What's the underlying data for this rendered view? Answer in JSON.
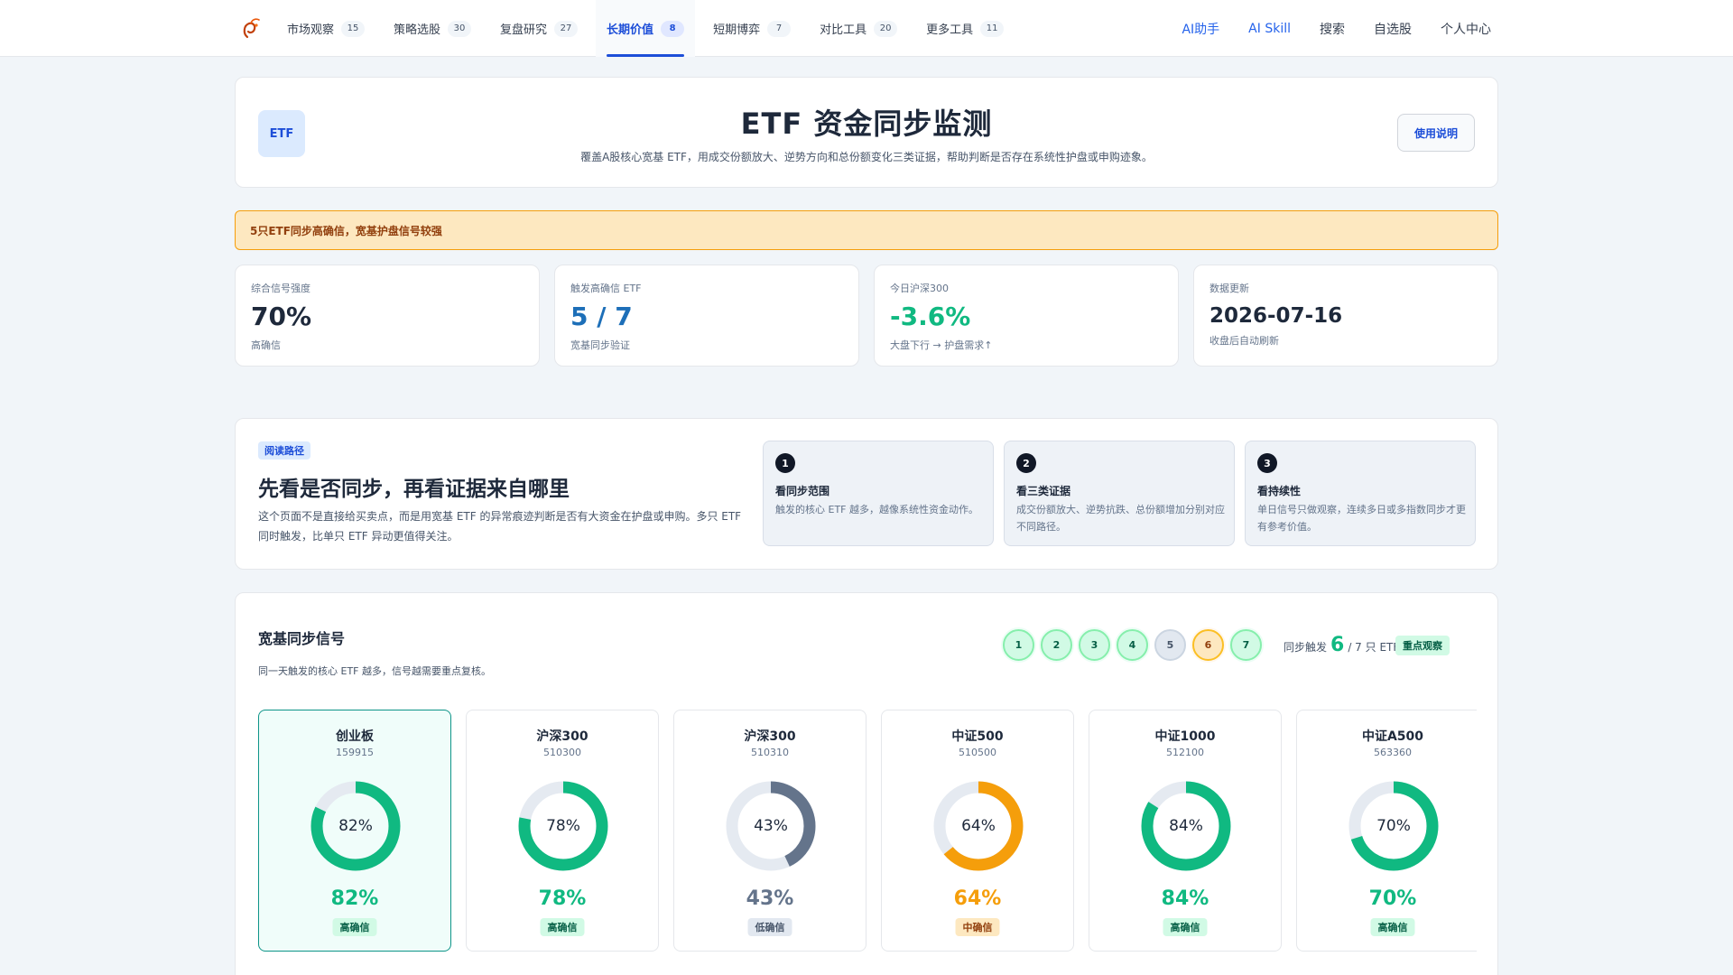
{
  "nav": {
    "tabs": [
      {
        "label": "市场观察",
        "count": "15"
      },
      {
        "label": "策略选股",
        "count": "30"
      },
      {
        "label": "复盘研究",
        "count": "27"
      },
      {
        "label": "长期价值",
        "count": "8"
      },
      {
        "label": "短期博弈",
        "count": "7"
      },
      {
        "label": "对比工具",
        "count": "20"
      },
      {
        "label": "更多工具",
        "count": "11"
      }
    ],
    "active_tab_index": 3,
    "links": {
      "ai_assistant": "AI助手",
      "ai_skill": "AI Skill",
      "search": "搜索",
      "watchlist": "自选股",
      "profile": "个人中心"
    }
  },
  "hero": {
    "badge": "ETF",
    "title": "ETF 资金同步监测",
    "subtitle": "覆盖A股核心宽基 ETF，用成交份额放大、逆势方向和总份额变化三类证据，帮助判断是否存在系统性护盘或申购迹象。",
    "help_button": "使用说明"
  },
  "alert": "5只ETF同步高确信，宽基护盘信号较强",
  "stats": [
    {
      "label": "综合信号强度",
      "value": "70%",
      "note": "高确信",
      "color": "#1e293b"
    },
    {
      "label": "触发高确信 ETF",
      "value": "5 / 7",
      "note": "宽基同步验证",
      "color": "#1d6fb8"
    },
    {
      "label": "今日沪深300",
      "value": "-3.6%",
      "note": "大盘下行 → 护盘需求↑",
      "color": "#10b981"
    },
    {
      "label": "数据更新",
      "value": "2026-07-16",
      "note": "收盘后自动刷新",
      "color": "#1e293b"
    }
  ],
  "guide": {
    "tag": "阅读路径",
    "title": "先看是否同步，再看证据来自哪里",
    "desc": "这个页面不是直接给买卖点，而是用宽基 ETF 的异常痕迹判断是否有大资金在护盘或申购。多只 ETF 同时触发，比单只 ETF 异动更值得关注。",
    "steps": [
      {
        "num": "1",
        "title": "看同步范围",
        "text": "触发的核心 ETF 越多，越像系统性资金动作。"
      },
      {
        "num": "2",
        "title": "看三类证据",
        "text": "成交份额放大、逆势抗跌、总份额增加分别对应不同路径。"
      },
      {
        "num": "3",
        "title": "看持续性",
        "text": "单日信号只做观察，连续多日或多指数同步才更有参考价值。"
      }
    ]
  },
  "sync": {
    "title": "宽基同步信号",
    "subtitle": "同一天触发的核心 ETF 越多，信号越需要重点复核。",
    "dots": [
      {
        "label": "1",
        "level": "hi"
      },
      {
        "label": "2",
        "level": "hi"
      },
      {
        "label": "3",
        "level": "hi"
      },
      {
        "label": "4",
        "level": "hi"
      },
      {
        "label": "5",
        "level": "lo"
      },
      {
        "label": "6",
        "level": "mid"
      },
      {
        "label": "7",
        "level": "hi"
      }
    ],
    "count_prefix": "同步触发",
    "count": "6",
    "count_suffix": "/ 7 只 ETF",
    "focus": "重点观察"
  },
  "etfs": [
    {
      "name": "创业板",
      "code": "159915",
      "value": 82,
      "pct": "82%",
      "level": "高确信",
      "tone": "hi",
      "selected": true
    },
    {
      "name": "沪深300",
      "code": "510300",
      "value": 78,
      "pct": "78%",
      "level": "高确信",
      "tone": "hi",
      "selected": false
    },
    {
      "name": "沪深300",
      "code": "510310",
      "value": 43,
      "pct": "43%",
      "level": "低确信",
      "tone": "lo",
      "selected": false
    },
    {
      "name": "中证500",
      "code": "510500",
      "value": 64,
      "pct": "64%",
      "level": "中确信",
      "tone": "mid",
      "selected": false
    },
    {
      "name": "中证1000",
      "code": "512100",
      "value": 84,
      "pct": "84%",
      "level": "高确信",
      "tone": "hi",
      "selected": false
    },
    {
      "name": "中证A500",
      "code": "563360",
      "value": 70,
      "pct": "70%",
      "level": "高确信",
      "tone": "hi",
      "selected": false
    }
  ],
  "tones": {
    "hi": {
      "ring": "#10b981",
      "text": "#10b981",
      "pill_bg": "#d1fae5",
      "pill_fg": "#065f46"
    },
    "mid": {
      "ring": "#f59e0b",
      "text": "#f59e0b",
      "pill_bg": "#fde8c0",
      "pill_fg": "#92400e"
    },
    "lo": {
      "ring": "#64748b",
      "text": "#64748b",
      "pill_bg": "#e2e8f0",
      "pill_fg": "#475569"
    }
  }
}
